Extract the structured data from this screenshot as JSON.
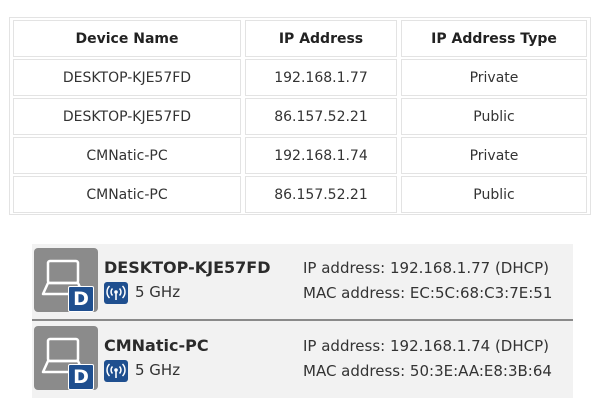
{
  "table": {
    "headers": [
      "Device Name",
      "IP Address",
      "IP Address Type"
    ],
    "rows": [
      [
        "DESKTOP-KJE57FD",
        "192.168.1.77",
        "Private"
      ],
      [
        "DESKTOP-KJE57FD",
        "86.157.52.21",
        "Public"
      ],
      [
        "CMNatic-PC",
        "192.168.1.74",
        "Private"
      ],
      [
        "CMNatic-PC",
        "86.157.52.21",
        "Public"
      ]
    ]
  },
  "devices": [
    {
      "name": "DESKTOP-KJE57FD",
      "badge": "D",
      "band": "5 GHz",
      "ip": "IP address: 192.168.1.77 (DHCP)",
      "mac": "MAC address: EC:5C:68:C3:7E:51"
    },
    {
      "name": "CMNatic-PC",
      "badge": "D",
      "band": "5 GHz",
      "ip": "IP address: 192.168.1.74 (DHCP)",
      "mac": "MAC address: 50:3E:AA:E8:3B:64"
    }
  ],
  "colors": {
    "badge": "#1f4f8f",
    "icon_bg": "#8b8b8b",
    "list_bg": "#f2f2f2"
  },
  "icons": {
    "device": "laptop-icon",
    "connection": "wifi-icon"
  }
}
